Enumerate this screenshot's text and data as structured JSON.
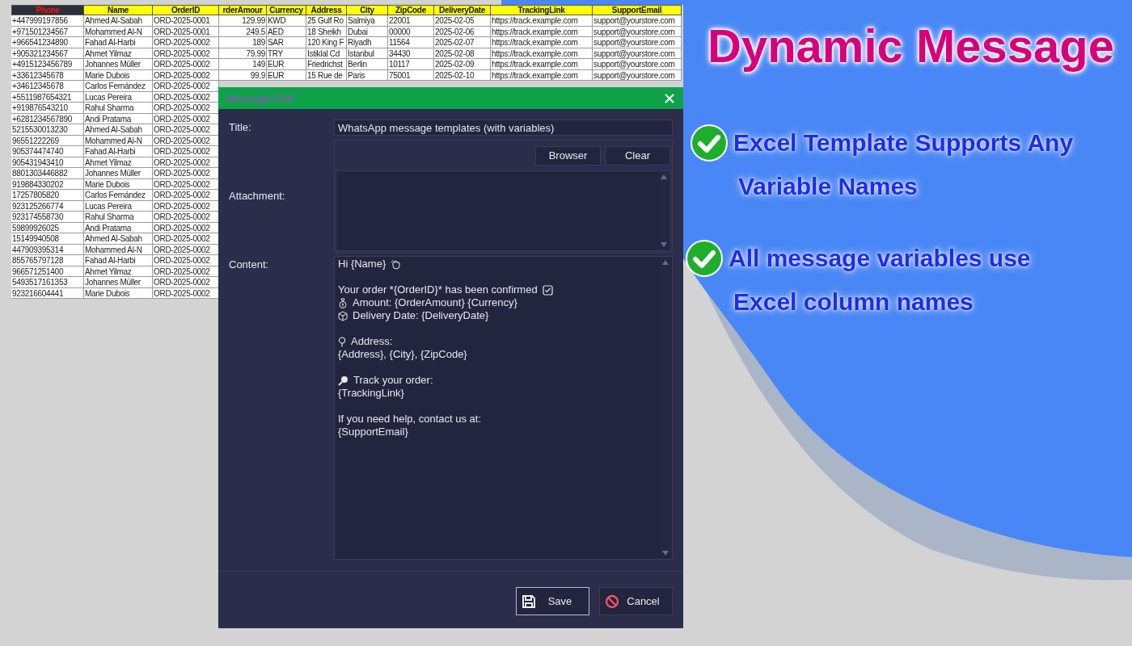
{
  "spreadsheet": {
    "columns": [
      {
        "label": "Phone",
        "kind": "key"
      },
      {
        "label": "Name",
        "kind": "text"
      },
      {
        "label": "OrderID",
        "kind": "text"
      },
      {
        "label": "rderAmour",
        "kind": "number"
      },
      {
        "label": "Currency",
        "kind": "text"
      },
      {
        "label": "Address",
        "kind": "text"
      },
      {
        "label": "City",
        "kind": "text"
      },
      {
        "label": "ZipCode",
        "kind": "text"
      },
      {
        "label": "DeliveryDate",
        "kind": "text"
      },
      {
        "label": "TrackingLink",
        "kind": "text"
      },
      {
        "label": "SupportEmail",
        "kind": "text"
      }
    ],
    "rows": [
      {
        "cells": [
          "+447999197856",
          "Ahmed Al-Sabah",
          "ORD-2025-0001",
          "129.99",
          "KWD",
          "25 Gulf Ro",
          "Salmiya",
          "22001",
          "2025-02-05",
          "https://track.example.com",
          "support@yourstore.com"
        ]
      },
      {
        "cells": [
          "+971501234567",
          "Mohammed Al-N",
          "ORD-2025-0001",
          "249.5",
          "AED",
          "18 Sheikh",
          "Dubai",
          "00000",
          "2025-02-06",
          "https://track.example.com",
          "support@yourstore.com"
        ]
      },
      {
        "cells": [
          "+966541234890",
          "Fahad Al-Harbi",
          "ORD-2025-0002",
          "189",
          "SAR",
          "120 King F",
          "Riyadh",
          "11564",
          "2025-02-07",
          "https://track.example.com",
          "support@yourstore.com"
        ]
      },
      {
        "cells": [
          "+905321234567",
          "Ahmet Yilmaz",
          "ORD-2025-0002",
          "79.99",
          "TRY",
          "Istiklal Cd",
          "Istanbul",
          "34430",
          "2025-02-08",
          "https://track.example.com",
          "support@yourstore.com"
        ]
      },
      {
        "cells": [
          "+4915123456789",
          "Johannes Müller",
          "ORD-2025-0002",
          "149",
          "EUR",
          "Friedrichst",
          "Berlin",
          "10117",
          "2025-02-09",
          "https://track.example.com",
          "support@yourstore.com"
        ]
      },
      {
        "cells": [
          "+33612345678",
          "Marie Dubois",
          "ORD-2025-0002",
          "99.9",
          "EUR",
          "15 Rue de",
          "Paris",
          "75001",
          "2025-02-10",
          "https://track.example.com",
          "support@yourstore.com"
        ]
      },
      {
        "cells": [
          "+34612345678",
          "Carlos Fernández",
          "ORD-2025-0002"
        ]
      },
      {
        "cells": [
          "+5511987654321",
          "Lucas Pereira",
          "ORD-2025-0002"
        ]
      },
      {
        "cells": [
          "+919876543210",
          "Rahul Sharma",
          "ORD-2025-0002"
        ]
      },
      {
        "cells": [
          "+6281234567890",
          "Andi Pratama",
          "ORD-2025-0002"
        ]
      },
      {
        "cells": [
          "5215530013230",
          "Ahmed Al-Sabah",
          "ORD-2025-0002"
        ]
      },
      {
        "cells": [
          "96551222269",
          "Mohammed Al-N",
          "ORD-2025-0002"
        ]
      },
      {
        "cells": [
          "905374474740",
          "Fahad Al-Harbi",
          "ORD-2025-0002"
        ]
      },
      {
        "cells": [
          "905431943410",
          "Ahmet Yilmaz",
          "ORD-2025-0002"
        ]
      },
      {
        "cells": [
          "8801303446882",
          "Johannes Müller",
          "ORD-2025-0002"
        ]
      },
      {
        "cells": [
          "919884330202",
          "Marie Dubois",
          "ORD-2025-0002"
        ]
      },
      {
        "cells": [
          "17257805820",
          "Carlos Fernández",
          "ORD-2025-0002"
        ]
      },
      {
        "cells": [
          "923125266774",
          "Lucas Pereira",
          "ORD-2025-0002"
        ]
      },
      {
        "cells": [
          "923174558730",
          "Rahul Sharma",
          "ORD-2025-0002"
        ]
      },
      {
        "cells": [
          "59899926025",
          "Andi Pratama",
          "ORD-2025-0002"
        ]
      },
      {
        "cells": [
          "15149940508",
          "Ahmed Al-Sabah",
          "ORD-2025-0002"
        ]
      },
      {
        "cells": [
          "447909395314",
          "Mohammed Al-N",
          "ORD-2025-0002"
        ]
      },
      {
        "cells": [
          "855765797128",
          "Fahad Al-Harbi",
          "ORD-2025-0002"
        ]
      },
      {
        "cells": [
          "966571251400",
          "Ahmet Yilmaz",
          "ORD-2025-0002"
        ]
      },
      {
        "cells": [
          "5493517161353",
          "Johannes Müller",
          "ORD-2025-0002"
        ]
      },
      {
        "cells": [
          "923216604441",
          "Marie Dubois",
          "ORD-2025-0002"
        ]
      }
    ]
  },
  "dialog": {
    "title": "Message Edit",
    "title_field": {
      "label": "Title:",
      "value": "WhatsApp message templates (with variables)"
    },
    "attachment": {
      "label": "Attachment:",
      "buttons": [
        "Browser",
        "Clear"
      ]
    },
    "content": {
      "label": "Content:",
      "lines": [
        {
          "kind": "greeting",
          "text": "Hi {Name}"
        },
        {
          "kind": "blank"
        },
        {
          "kind": "confirmed",
          "text": "Your order *{OrderID}* has been confirmed"
        },
        {
          "kind": "amount",
          "text": "Amount: {OrderAmount} {Currency}"
        },
        {
          "kind": "delivery",
          "text": "Delivery Date: {DeliveryDate}"
        },
        {
          "kind": "blank"
        },
        {
          "kind": "address",
          "text": "Address:"
        },
        {
          "kind": "plain",
          "text": "{Address}, {City}, {ZipCode}"
        },
        {
          "kind": "blank"
        },
        {
          "kind": "track",
          "text": "Track your order:"
        },
        {
          "kind": "plain",
          "text": "{TrackingLink}"
        },
        {
          "kind": "blank"
        },
        {
          "kind": "plain",
          "text": "If you need help, contact us at:"
        },
        {
          "kind": "plain",
          "text": "{SupportEmail}"
        }
      ]
    },
    "actions": [
      {
        "kind": "save",
        "label": "Save",
        "default": true
      },
      {
        "kind": "cancel",
        "label": "Cancel",
        "default": false
      }
    ]
  },
  "promo": {
    "headline": "Dynamic Message",
    "features": [
      {
        "lines": [
          "Excel Template Supports Any",
          "Variable Names"
        ]
      },
      {
        "lines": [
          "All message variables use",
          "Excel column names"
        ]
      }
    ]
  }
}
